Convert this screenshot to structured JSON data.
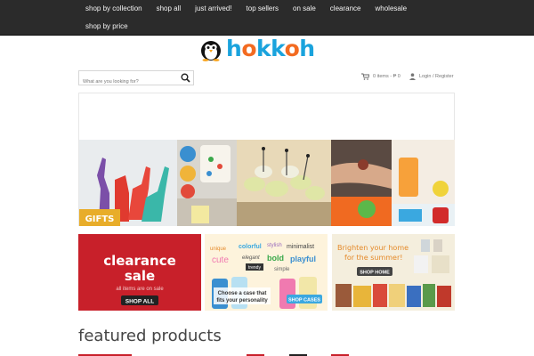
{
  "nav": {
    "row1": [
      "shop by collection",
      "shop all",
      "just arrived!",
      "top sellers",
      "on sale",
      "clearance",
      "wholesale"
    ],
    "row2": [
      "shop by price"
    ]
  },
  "logo": {
    "text_a": "h",
    "text_o1": "o",
    "text_kk": "kk",
    "text_o2": "o",
    "text_h": "h"
  },
  "search": {
    "placeholder": "What are you looking for?"
  },
  "header": {
    "cart_label": "0 items - ₱ 0",
    "login_label": "Login / Register"
  },
  "banner": {
    "gifts_label": "GIFTS"
  },
  "promos": {
    "clearance": {
      "line1": "clearance",
      "line2": "sale",
      "sub": "all items are on sale",
      "button": "SHOP ALL"
    },
    "cases": {
      "words": [
        "unique",
        "colorful",
        "stylish",
        "minimalist",
        "cute",
        "elegant",
        "bold",
        "playful",
        "trendy",
        "simple"
      ],
      "caption1": "Choose a case that",
      "caption2": "fits your personality",
      "button": "SHOP CASES"
    },
    "home": {
      "line1": "Brighten your home",
      "line2": "for the summer!",
      "button": "SHOP HOME"
    }
  },
  "featured": {
    "title": "featured products"
  },
  "colors": {
    "nav_bg": "#2b2b2b",
    "logo_blue": "#1aa3dd",
    "logo_orange": "#f36b21",
    "clearance_red": "#c8202a",
    "cases_bg": "#fdf3dc",
    "home_bg": "#f4eedd"
  }
}
